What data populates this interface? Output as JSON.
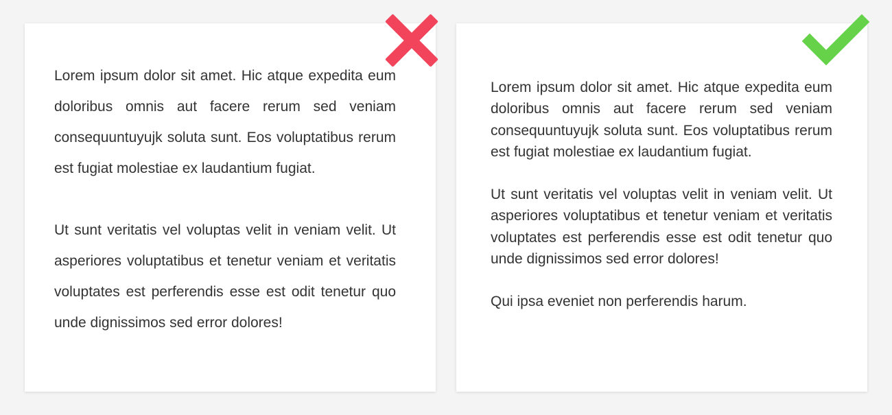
{
  "colors": {
    "background": "#f4f4f4",
    "card": "#ffffff",
    "text": "#333333",
    "bad_mark": "#f2455c",
    "good_mark": "#66d24a"
  },
  "bad_example": {
    "verdict_icon": "cross-icon",
    "paragraphs": [
      "Lorem ipsum dolor sit amet. Hic atque expedita eum doloribus omnis aut facere rerum sed veniam consequuntuyujk soluta sunt. Eos voluptatibus rerum est fugiat molestiae ex lau­dantium fugiat.",
      "Ut sunt veritatis vel voluptas velit in veniam velit. Ut asperiores voluptatibus et tenetur veniam et veritatis voluptates est perferendis esse est odit tenetur quo unde dignissimos sed error dolores!"
    ]
  },
  "good_example": {
    "verdict_icon": "checkmark-icon",
    "paragraphs": [
      "Lorem ipsum dolor sit amet. Hic atque expedita eum doloribus omnis aut facere rerum sed veniam consequuntuyujk soluta sunt. Eos voluptatibus rerum est fugiat molestiae ex lau­dantium fugiat.",
      "Ut sunt veritatis vel voluptas velit in veniam velit. Ut asperiores voluptatibus et tenetur veniam et veritatis voluptates est perferendis esse est odit tenetur quo unde dignissimos sed error dolores!",
      "Qui ipsa eveniet non perferendis harum."
    ]
  }
}
